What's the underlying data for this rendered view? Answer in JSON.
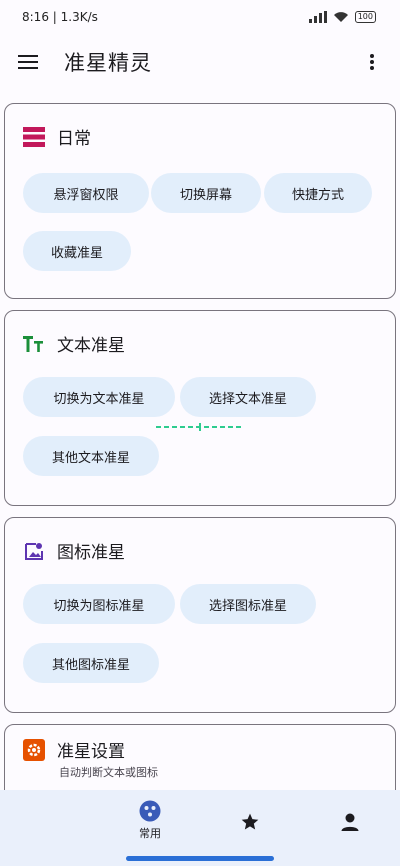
{
  "status": {
    "time": "8:16",
    "speed": "1.3K/s",
    "battery": "100"
  },
  "app_bar": {
    "title": "准星精灵"
  },
  "cards": {
    "daily": {
      "title": "日常",
      "chips": [
        "悬浮窗权限",
        "切换屏幕",
        "快捷方式",
        "收藏准星"
      ]
    },
    "text": {
      "title": "文本准星",
      "chips": [
        "切换为文本准星",
        "选择文本准星",
        "其他文本准星"
      ]
    },
    "icon": {
      "title": "图标准星",
      "chips": [
        "切换为图标准星",
        "选择图标准星",
        "其他图标准星"
      ]
    },
    "settings": {
      "title": "准星设置",
      "subtitle": "自动判断文本或图标"
    }
  },
  "bottom_nav": {
    "home_label": "常用"
  },
  "colors": {
    "accent_red": "#c2185b",
    "accent_green": "#1b8f3a",
    "accent_purple": "#5e35b1",
    "accent_orange": "#e65100",
    "chip_bg": "#e2eefb",
    "nav_bg": "#eaf0fb",
    "crosshair": "#2ecc8f"
  },
  "icons": {
    "daily": "stacked-bars-icon",
    "text": "text-size-icon",
    "icon": "image-person-icon",
    "settings": "gear-icon"
  }
}
